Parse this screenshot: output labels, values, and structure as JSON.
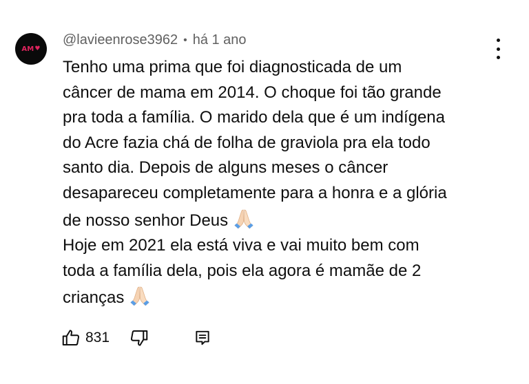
{
  "comment": {
    "avatar_text": "AM",
    "author": "@lavieenrose3962",
    "separator": "•",
    "timestamp": "há 1 ano",
    "lines": [
      "Tenho uma prima que foi diagnosticada de um",
      "câncer de mama em 2014.  O choque foi tão grande",
      "pra toda a família. O marido dela que é um indígena",
      "do Acre fazia chá de folha de graviola pra ela todo",
      "santo dia. Depois de alguns meses o câncer",
      "desapareceu completamente para a honra e a glória",
      "de nosso senhor Deus",
      "Hoje em 2021 ela está viva e vai muito bem com",
      "toda a família dela, pois ela agora é mamãe de 2",
      "crianças"
    ],
    "like_count": "831"
  },
  "icons": {
    "avatar_heart": "heart-icon",
    "menu": "more-vert-icon",
    "emoji": "folded-hands-emoji",
    "like": "thumb-up-icon",
    "dislike": "thumb-down-icon",
    "reply": "reply-comment-icon"
  },
  "colors": {
    "text": "#0f0f0f",
    "secondary": "#606060",
    "avatar_bg": "#0a0a0a",
    "avatar_accent": "#e0245e"
  }
}
